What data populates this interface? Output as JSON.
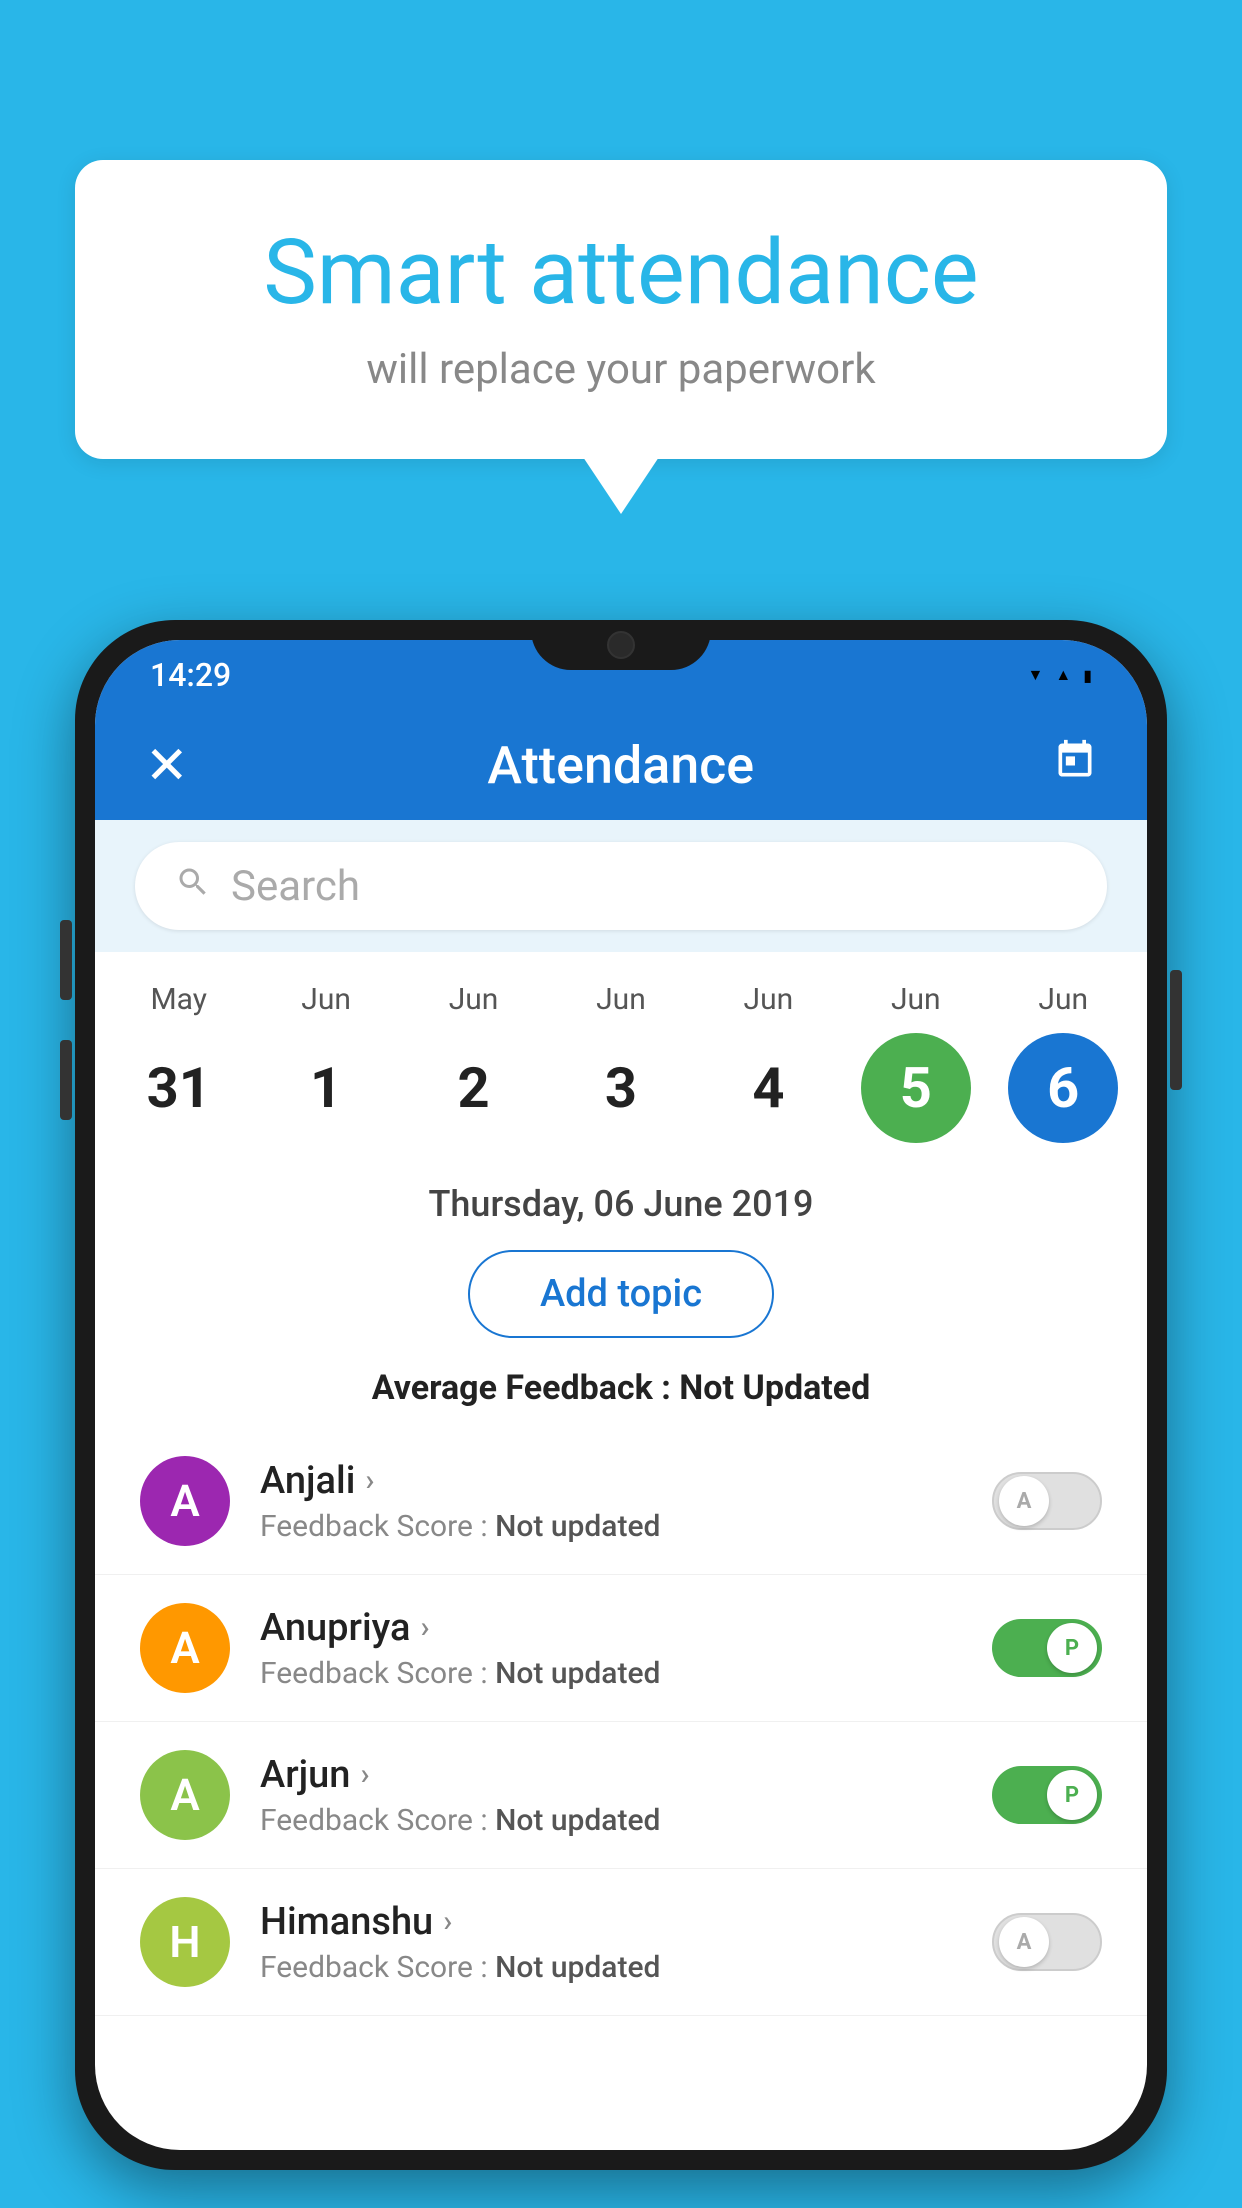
{
  "background_color": "#29b6e8",
  "speech_bubble": {
    "title": "Smart attendance",
    "subtitle": "will replace your paperwork"
  },
  "status_bar": {
    "time": "14:29",
    "wifi": "▾",
    "signal": "▲",
    "battery": "▮"
  },
  "app_bar": {
    "title": "Attendance",
    "close_label": "✕",
    "calendar_label": "📅"
  },
  "search": {
    "placeholder": "Search"
  },
  "calendar": {
    "days": [
      {
        "month": "May",
        "date": "31",
        "state": "normal"
      },
      {
        "month": "Jun",
        "date": "1",
        "state": "normal"
      },
      {
        "month": "Jun",
        "date": "2",
        "state": "normal"
      },
      {
        "month": "Jun",
        "date": "3",
        "state": "normal"
      },
      {
        "month": "Jun",
        "date": "4",
        "state": "normal"
      },
      {
        "month": "Jun",
        "date": "5",
        "state": "today"
      },
      {
        "month": "Jun",
        "date": "6",
        "state": "selected"
      }
    ]
  },
  "date_full": "Thursday, 06 June 2019",
  "add_topic_label": "Add topic",
  "average_feedback": {
    "label": "Average Feedback : ",
    "value": "Not Updated"
  },
  "students": [
    {
      "name": "Anjali",
      "avatar_letter": "A",
      "avatar_color": "#9c27b0",
      "feedback_label": "Feedback Score : ",
      "feedback_value": "Not updated",
      "toggle_state": "off",
      "toggle_letter": "A"
    },
    {
      "name": "Anupriya",
      "avatar_letter": "A",
      "avatar_color": "#ff9800",
      "feedback_label": "Feedback Score : ",
      "feedback_value": "Not updated",
      "toggle_state": "on",
      "toggle_letter": "P"
    },
    {
      "name": "Arjun",
      "avatar_letter": "A",
      "avatar_color": "#8bc34a",
      "feedback_label": "Feedback Score : ",
      "feedback_value": "Not updated",
      "toggle_state": "on",
      "toggle_letter": "P"
    },
    {
      "name": "Himanshu",
      "avatar_letter": "H",
      "avatar_color": "#a5c842",
      "feedback_label": "Feedback Score : ",
      "feedback_value": "Not updated",
      "toggle_state": "off",
      "toggle_letter": "A"
    }
  ]
}
